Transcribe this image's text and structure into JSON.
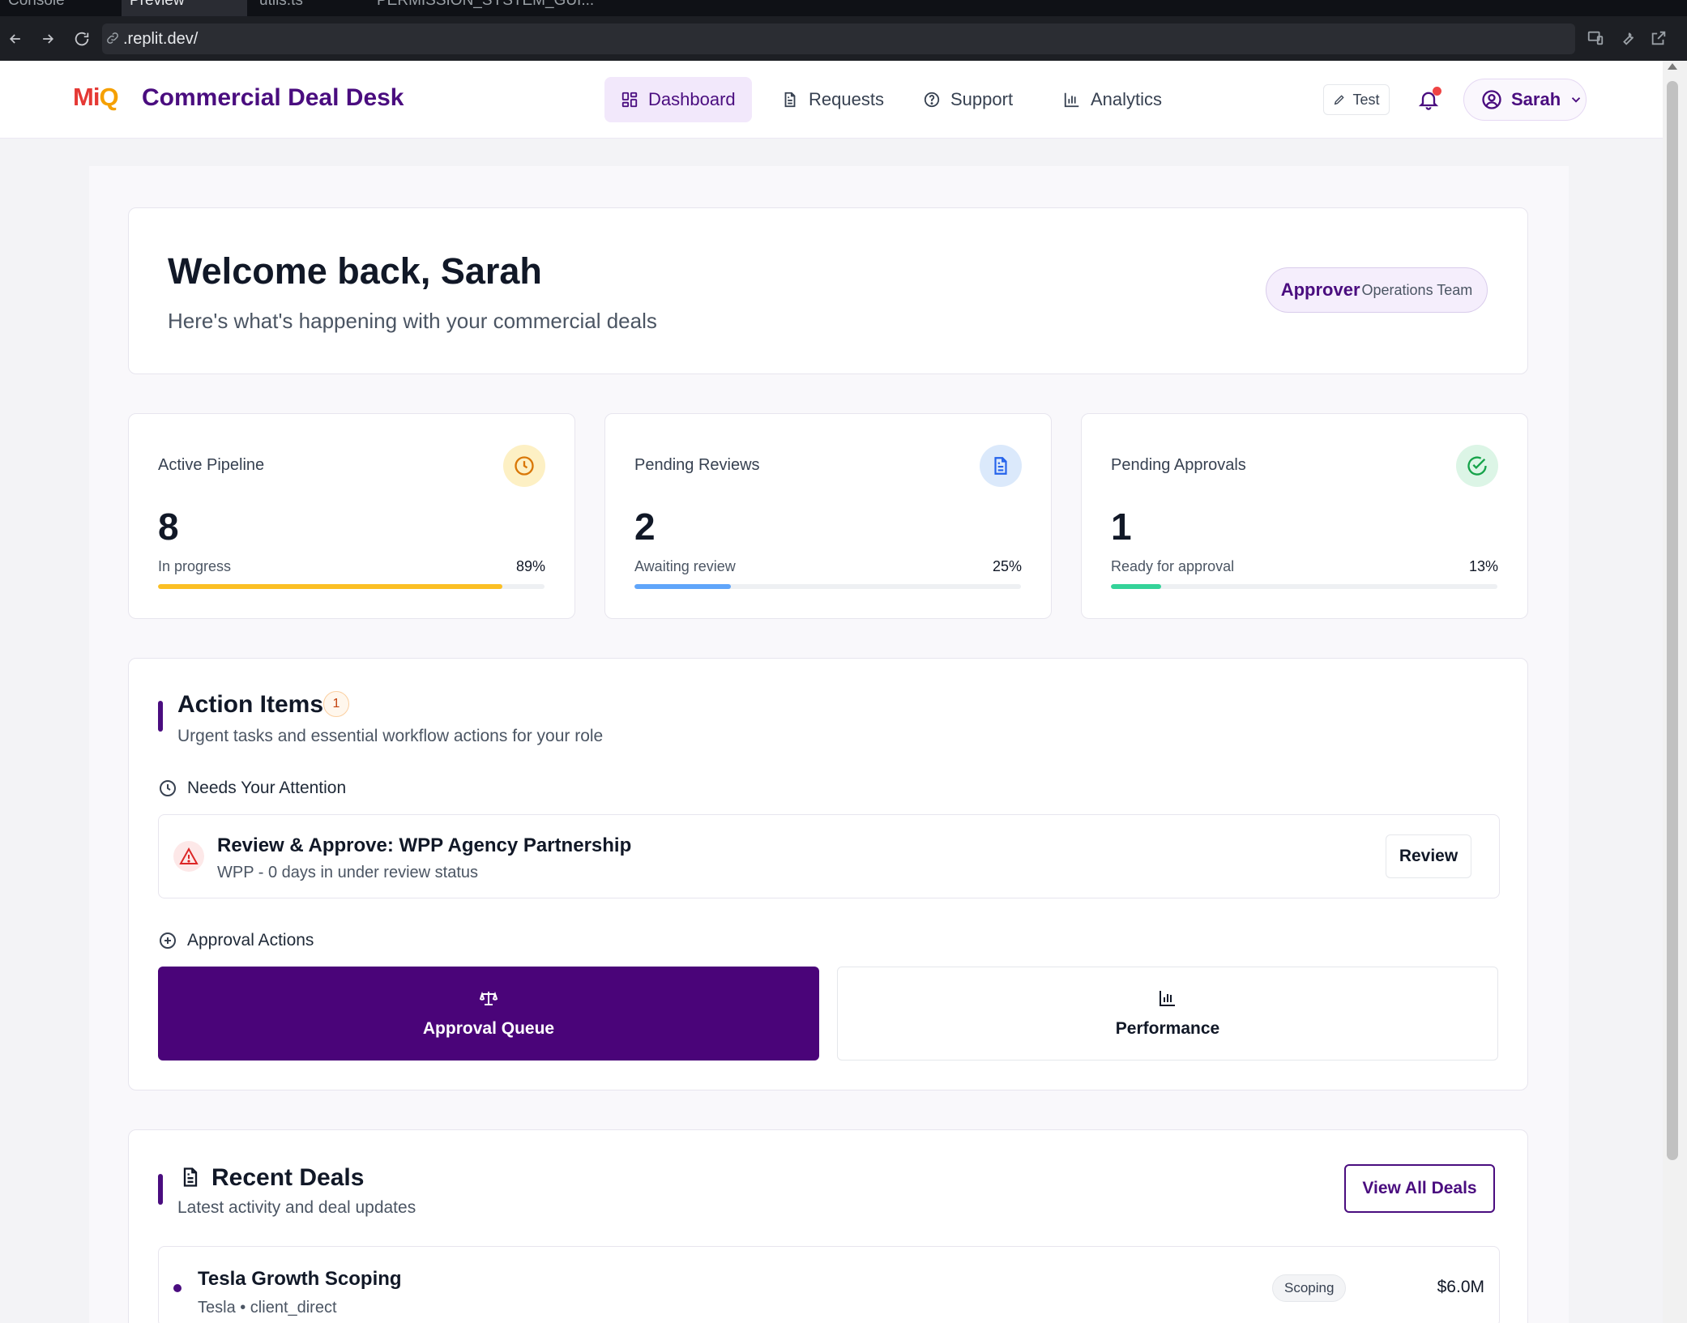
{
  "browser": {
    "tabs": [
      "Console",
      "Preview",
      "utils.ts",
      "PERMISSION_SYSTEM_GUI..."
    ],
    "url": ".replit.dev/"
  },
  "header": {
    "logo": {
      "mi": "Mi",
      "q": "Q"
    },
    "app_title": "Commercial Deal Desk",
    "nav": [
      {
        "label": "Dashboard",
        "icon": "grid-icon"
      },
      {
        "label": "Requests",
        "icon": "file-icon"
      },
      {
        "label": "Support",
        "icon": "help-circle-icon"
      },
      {
        "label": "Analytics",
        "icon": "bar-chart-icon"
      }
    ],
    "test_label": "Test",
    "user_name": "Sarah"
  },
  "welcome": {
    "title": "Welcome back, Sarah",
    "subtitle": "Here's what's happening with your commercial deals",
    "role": "Approver",
    "team": "Operations Team"
  },
  "stats": [
    {
      "label": "Active Pipeline",
      "value": "8",
      "sub": "In progress",
      "percent_text": "89%",
      "percent": 89,
      "color": "#fbbf24",
      "icon": "clock-icon"
    },
    {
      "label": "Pending Reviews",
      "value": "2",
      "sub": "Awaiting review",
      "percent_text": "25%",
      "percent": 25,
      "color": "#60a5fa",
      "icon": "document-icon"
    },
    {
      "label": "Pending Approvals",
      "value": "1",
      "sub": "Ready for approval",
      "percent_text": "13%",
      "percent": 13,
      "color": "#34d399",
      "icon": "check-circle-icon"
    }
  ],
  "action_items": {
    "title": "Action Items",
    "count": "1",
    "subtitle": "Urgent tasks and essential workflow actions for your role",
    "attention_heading": "Needs Your Attention",
    "attention_item": {
      "title": "Review & Approve: WPP Agency Partnership",
      "subtitle": "WPP - 0 days in under review status",
      "button": "Review"
    },
    "approval_heading": "Approval Actions",
    "buttons": [
      {
        "label": "Approval Queue",
        "icon": "scale-icon"
      },
      {
        "label": "Performance",
        "icon": "bar-chart-icon"
      }
    ]
  },
  "recent_deals": {
    "title": "Recent Deals",
    "subtitle": "Latest activity and deal updates",
    "view_all": "View All Deals",
    "deals": [
      {
        "name": "Tesla Growth Scoping",
        "meta": "Tesla • client_direct",
        "stage": "Scoping",
        "amount": "$6.0M"
      }
    ]
  },
  "colors": {
    "brand": "#4a0d7f",
    "primary_button": "#4a0479"
  }
}
